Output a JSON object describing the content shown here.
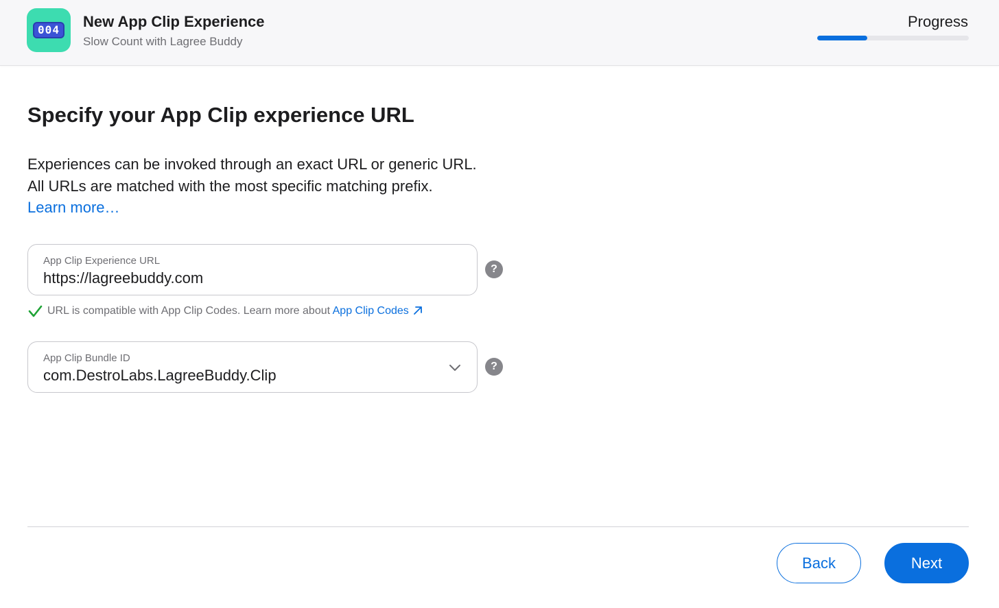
{
  "header": {
    "app_icon_text": "004",
    "title": "New App Clip Experience",
    "subtitle": "Slow Count with Lagree Buddy",
    "progress_label": "Progress",
    "progress_fraction": 0.33,
    "accent_color": "#0a6fde",
    "icon_color": "#3ddcb0"
  },
  "main": {
    "heading": "Specify your App Clip experience URL",
    "description_lines": [
      "Experiences can be invoked through an exact URL or generic URL.",
      "All URLs are matched with the most specific matching prefix."
    ],
    "learn_more": "Learn more…",
    "url_field": {
      "label": "App Clip Experience URL",
      "value": "https://lagreebuddy.com",
      "help_icon": "?"
    },
    "hint": {
      "icon": "checkmark-icon",
      "text": "URL is compatible with App Clip Codes. Learn more about ",
      "link_text": "App Clip Codes",
      "link_icon": "external-arrow-icon"
    },
    "bundle_field": {
      "label": "App Clip Bundle ID",
      "value": "com.DestroLabs.LagreeBuddy.Clip",
      "help_icon": "?"
    }
  },
  "footer": {
    "back_label": "Back",
    "next_label": "Next"
  }
}
